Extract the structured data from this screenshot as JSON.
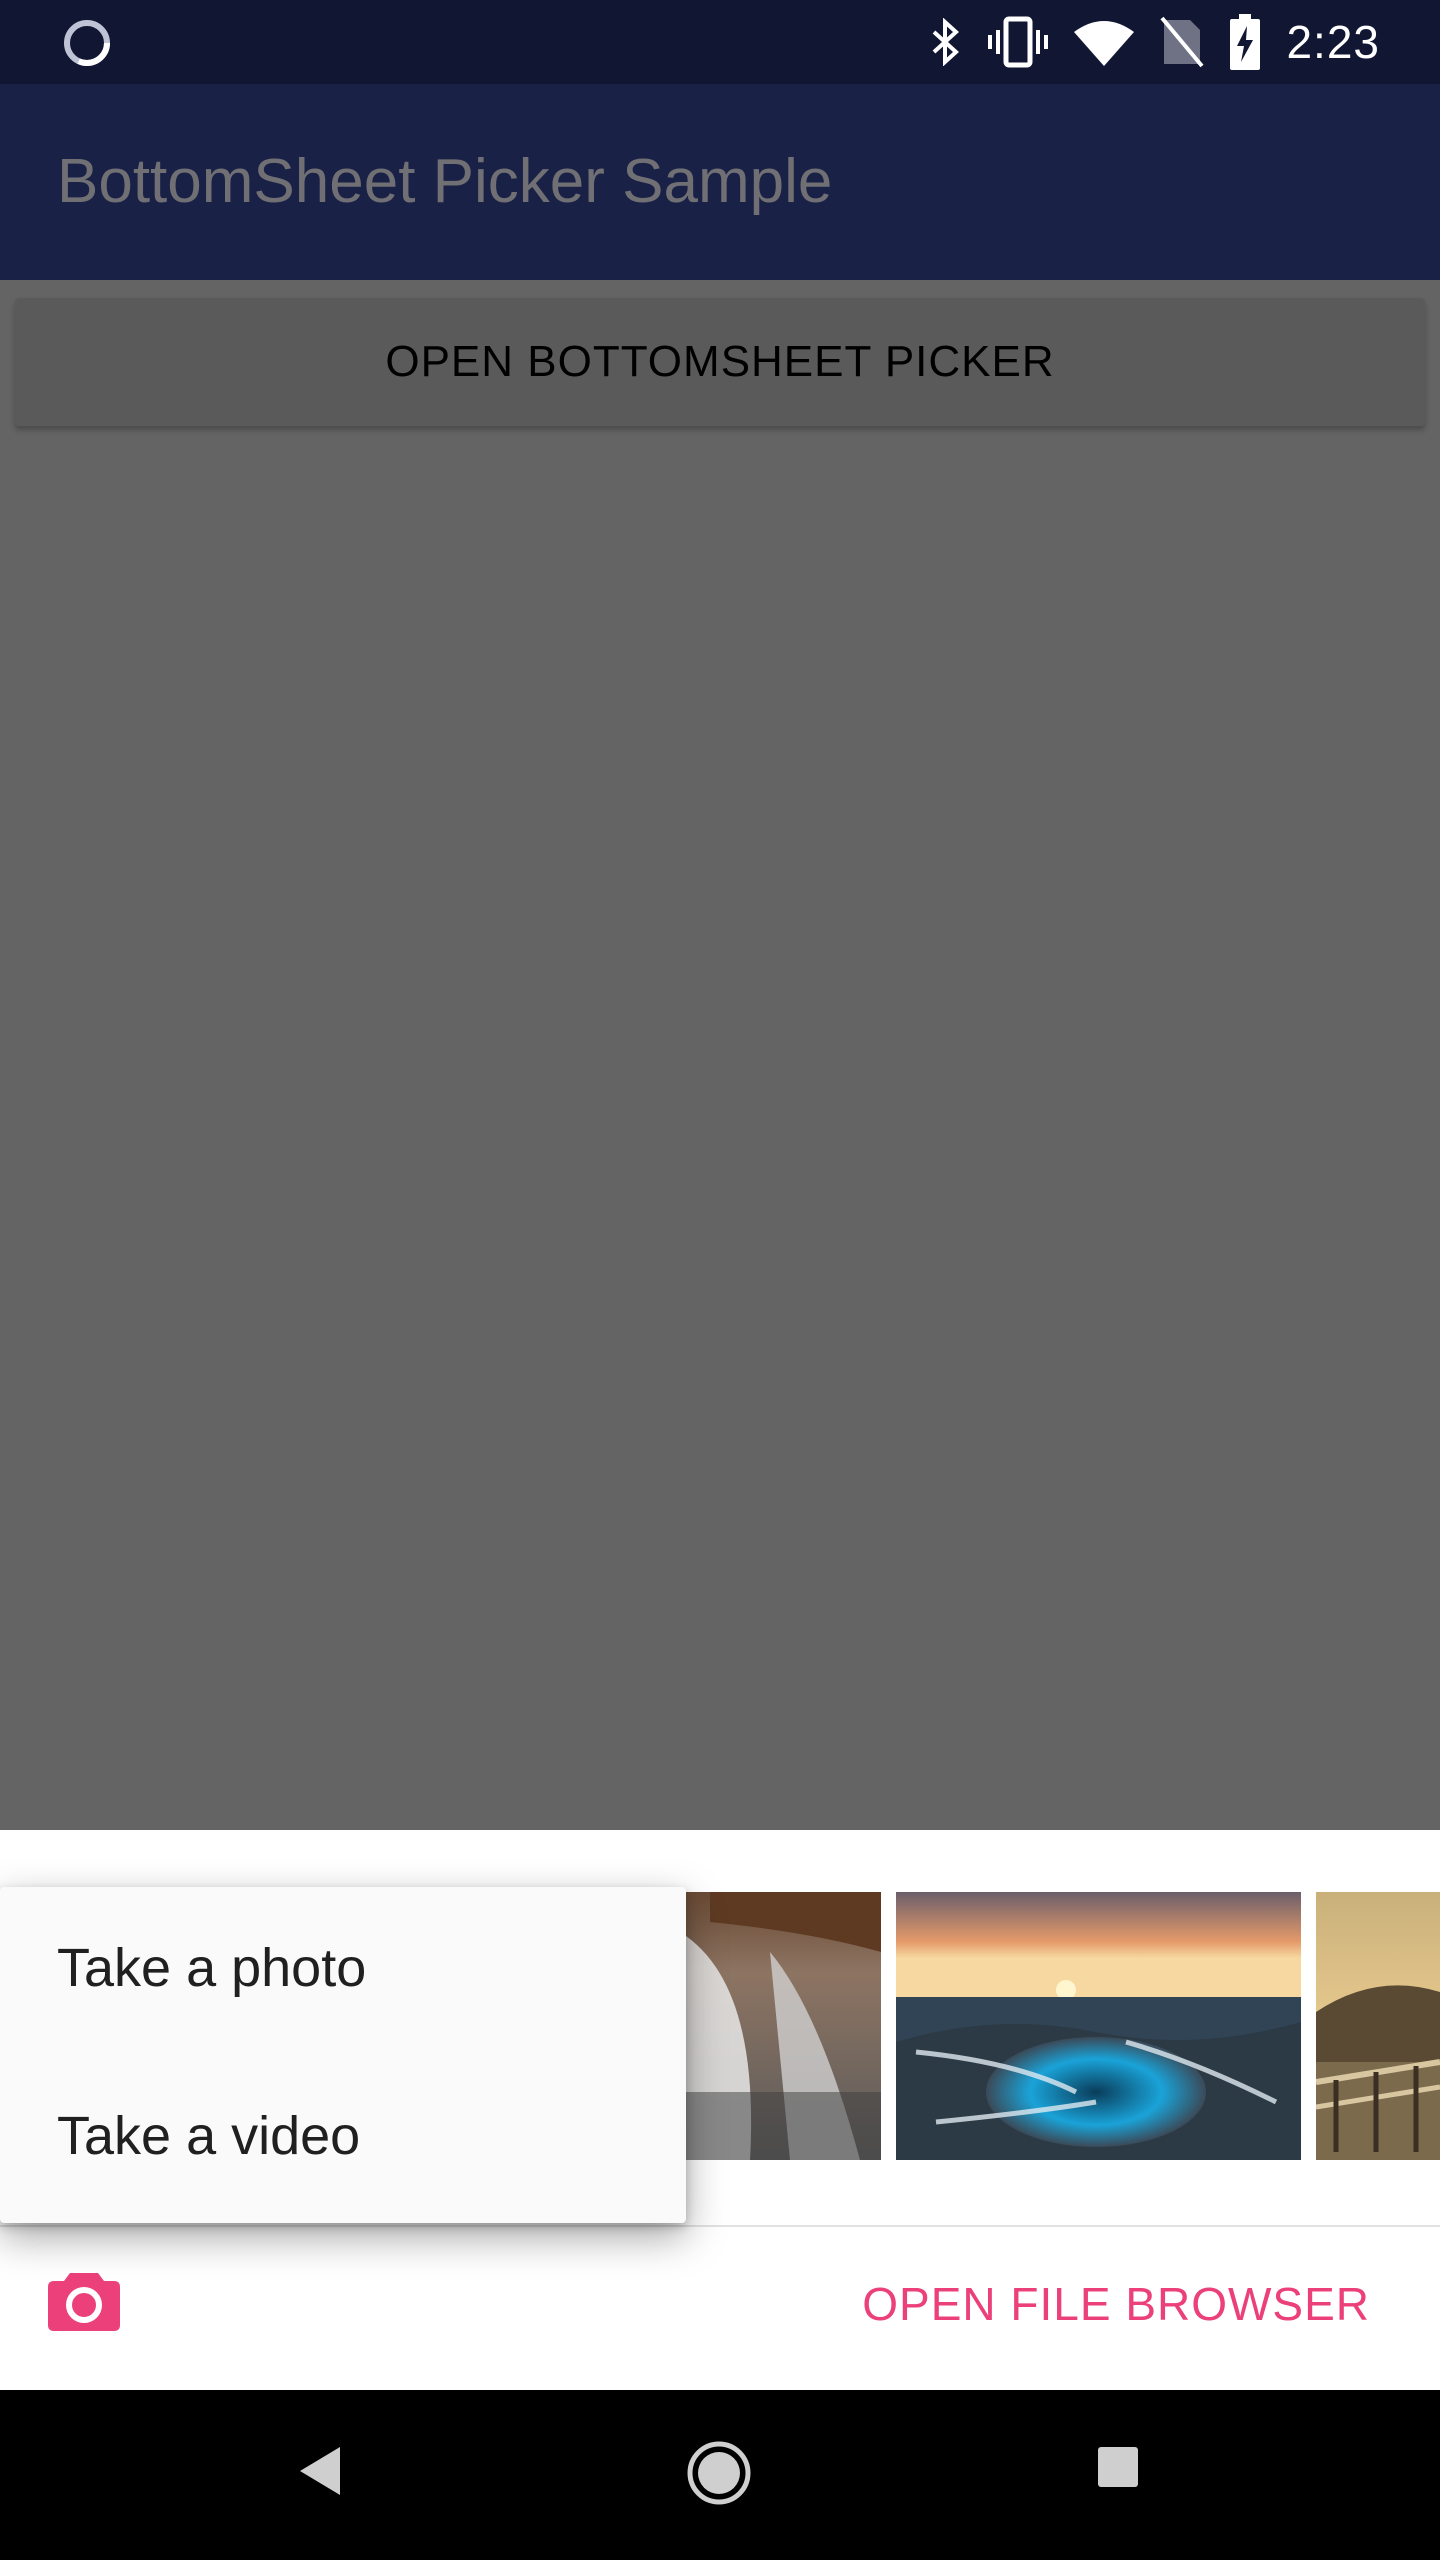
{
  "status_bar": {
    "time": "2:23",
    "icons": [
      "loading-icon",
      "bluetooth-icon",
      "vibrate-icon",
      "wifi-icon",
      "no-sim-icon",
      "battery-charging-icon"
    ]
  },
  "app_bar": {
    "title": "BottomSheet Picker Sample"
  },
  "main": {
    "open_button_label": "OPEN BOTTOMSHEET PICKER"
  },
  "bottom_sheet": {
    "thumbnails": [
      "waterfall-photo",
      "tide-pool-sunset-photo",
      "pier-photo"
    ],
    "camera_icon": "camera-icon",
    "open_file_browser_label": "OPEN FILE BROWSER",
    "accent_color": "#ec407a"
  },
  "camera_menu": {
    "items": [
      {
        "label": "Take a photo"
      },
      {
        "label": "Take a video"
      }
    ]
  },
  "nav_bar": {
    "icons": [
      "back-icon",
      "home-icon",
      "recents-icon"
    ]
  }
}
